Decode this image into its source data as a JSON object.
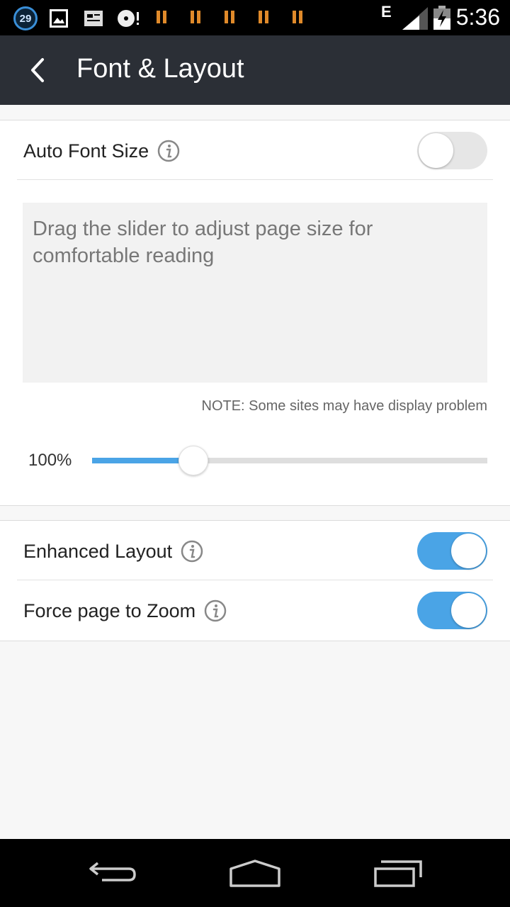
{
  "status_bar": {
    "notification_count": "29",
    "network_type": "E",
    "time": "5:36",
    "icons": [
      "picture-icon",
      "media-icon",
      "disc-icon",
      "pause-icon",
      "pause-icon",
      "pause-icon",
      "pause-icon",
      "pause-icon",
      "signal-icon",
      "battery-charging-icon"
    ]
  },
  "toolbar": {
    "back_icon": "chevron-left-icon",
    "title": "Font & Layout"
  },
  "font_section": {
    "auto_font_size": {
      "label": "Auto Font Size",
      "enabled": false
    },
    "preview_text": "Drag the slider to adjust page size for comfortable reading",
    "note": "NOTE: Some sites may have display problem",
    "slider": {
      "value_label": "100%",
      "fraction": 0.25
    }
  },
  "layout_section": {
    "enhanced_layout": {
      "label": "Enhanced Layout",
      "enabled": true
    },
    "force_zoom": {
      "label": "Force page to Zoom",
      "enabled": true
    }
  },
  "nav_bar": {
    "buttons": [
      "back-icon",
      "home-icon",
      "recents-icon"
    ]
  },
  "colors": {
    "accent": "#4aa4e6",
    "toolbar": "#2b2f36",
    "status_orange": "#e08a2a"
  }
}
